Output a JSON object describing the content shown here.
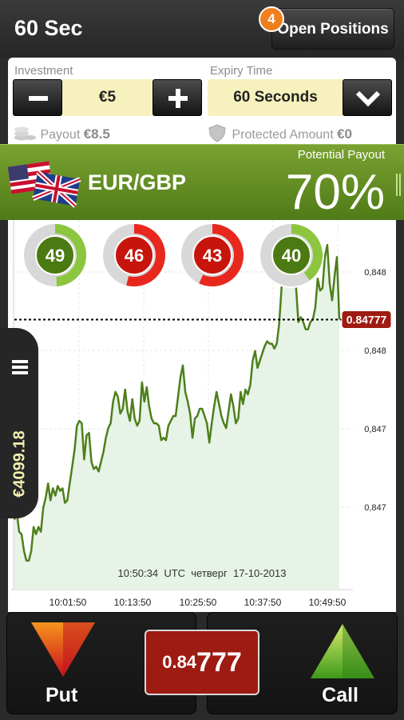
{
  "header": {
    "timer": "60 Sec",
    "open_positions_label": "Open Positions",
    "open_positions_count": "4"
  },
  "investment": {
    "label": "Investment",
    "value": "€5",
    "payout_label": "Payout",
    "payout_value": "€8.5"
  },
  "expiry": {
    "label": "Expiry Time",
    "value": "60 Seconds",
    "protected_label": "Protected Amount",
    "protected_value": "€0"
  },
  "asset": {
    "name": "EUR/GBP",
    "payout_label": "Potential Payout",
    "payout_value": "70%"
  },
  "sentiment": [
    {
      "value": "49",
      "color": "green",
      "fraction": 0.49
    },
    {
      "value": "46",
      "color": "red",
      "fraction": 0.54
    },
    {
      "value": "43",
      "color": "red",
      "fraction": 0.57
    },
    {
      "value": "40",
      "color": "green",
      "fraction": 0.4
    }
  ],
  "balance": "€4099.18",
  "chart_data": {
    "type": "area",
    "timestamp": "10:50:34  UTC  четверг  17-10-2013",
    "x_ticks": [
      "10:01:50",
      "10:13:50",
      "10:25:50",
      "10:37:50",
      "10:49:50"
    ],
    "y_ticks": [
      "0,848",
      "0,848",
      "0,847",
      "0,847"
    ],
    "current_price": "0.84777",
    "colors": {
      "line": "#4e7f1b",
      "fill": "#e6f3e6",
      "price_tag": "#9e1b12"
    },
    "values": [
      0.84694,
      0.84697,
      0.84689,
      0.84688,
      0.84681,
      0.84677,
      0.84677,
      0.84681,
      0.84691,
      0.84688,
      0.84691,
      0.84689,
      0.84699,
      0.84703,
      0.84709,
      0.84702,
      0.84707,
      0.84704,
      0.84708,
      0.84706,
      0.84707,
      0.84701,
      0.84702,
      0.84709,
      0.84716,
      0.84723,
      0.84733,
      0.84735,
      0.84734,
      0.84719,
      0.84729,
      0.8473,
      0.84718,
      0.84715,
      0.84716,
      0.84714,
      0.84718,
      0.84722,
      0.84728,
      0.84732,
      0.84734,
      0.84743,
      0.84747,
      0.84745,
      0.84738,
      0.8474,
      0.84748,
      0.84739,
      0.84735,
      0.84744,
      0.84736,
      0.84733,
      0.84735,
      0.84751,
      0.84743,
      0.84749,
      0.84741,
      0.84736,
      0.84734,
      0.84734,
      0.84733,
      0.84727,
      0.84728,
      0.84727,
      0.84733,
      0.84735,
      0.84737,
      0.84737,
      0.84745,
      0.84753,
      0.84758,
      0.84747,
      0.84743,
      0.84738,
      0.84728,
      0.84736,
      0.84737,
      0.8474,
      0.8474,
      0.84737,
      0.84734,
      0.84726,
      0.84734,
      0.84741,
      0.84747,
      0.84742,
      0.84737,
      0.84734,
      0.84732,
      0.84739,
      0.84746,
      0.84741,
      0.84734,
      0.84736,
      0.84747,
      0.84742,
      0.84748,
      0.84746,
      0.8475,
      0.8476,
      0.84764,
      0.84757,
      0.8476,
      0.84763,
      0.84766,
      0.84768,
      0.84767,
      0.84767,
      0.84765,
      0.84767,
      0.84775,
      0.8479,
      0.84806,
      0.84805,
      0.84795,
      0.84801,
      0.84798,
      0.84791,
      0.84776,
      0.84778,
      0.84776,
      0.84773,
      0.84773,
      0.84776,
      0.84777,
      0.84782,
      0.84794,
      0.84789,
      0.8479,
      0.84803,
      0.84808,
      0.84792,
      0.84785,
      0.84795,
      0.84803,
      0.84777
    ]
  },
  "footer": {
    "put_label": "Put",
    "call_label": "Call",
    "price_small": "0.84",
    "price_big": "777"
  }
}
